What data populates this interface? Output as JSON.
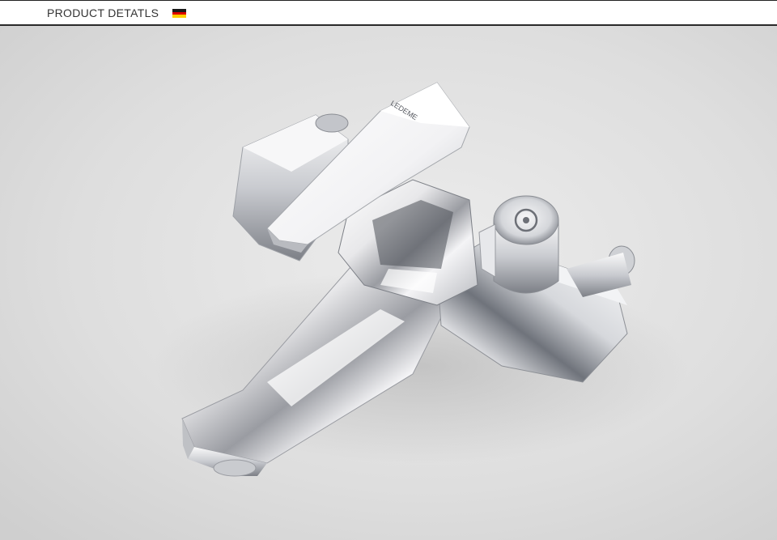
{
  "header": {
    "title": "PRODUCT DETATLS",
    "flag_icon": "germany-flag-icon",
    "flag_colors": [
      "#1a1a1a",
      "#dd0000",
      "#ffce00"
    ]
  },
  "photo": {
    "subject": "faucet-icon",
    "brand_text": "LEDEME",
    "background_color": "#d9d9d9"
  }
}
